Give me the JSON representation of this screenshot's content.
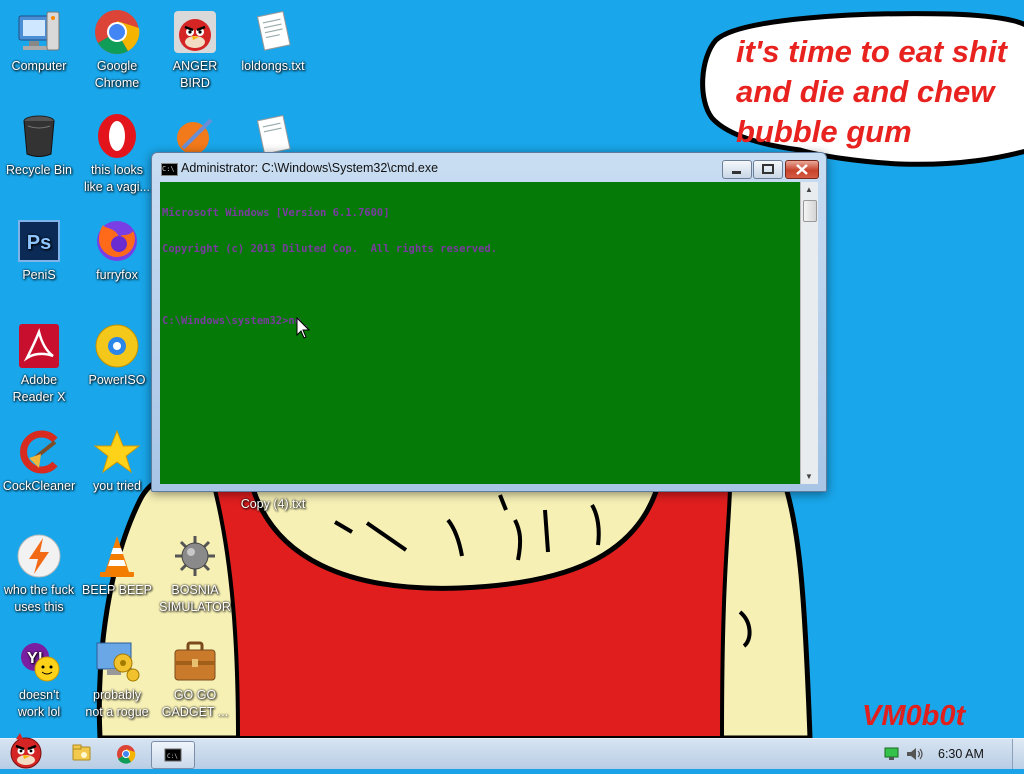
{
  "desktop_icons": [
    {
      "name": "icon-computer",
      "icon": "computer-icon",
      "label": "Computer"
    },
    {
      "name": "icon-google-chrome",
      "icon": "chrome-icon",
      "label": "Google\nChrome"
    },
    {
      "name": "icon-anger-bird",
      "icon": "angry-bird-icon",
      "label": "ANGER\nBIRD"
    },
    {
      "name": "icon-loldongs",
      "icon": "text-file-icon",
      "label": "loldongs.txt"
    },
    {
      "name": "icon-recycle-bin",
      "icon": "recycle-bin-icon",
      "label": "Recycle Bin"
    },
    {
      "name": "icon-opera",
      "icon": "opera-icon",
      "label": "this looks\nlike a vagi..."
    },
    {
      "name": "icon-photoshop",
      "icon": "photoshop-icon",
      "label": "PeniS"
    },
    {
      "name": "icon-firefox",
      "icon": "firefox-icon",
      "label": "furryfox"
    },
    {
      "name": "icon-adobe-reader",
      "icon": "adobe-reader-icon",
      "label": "Adobe\nReader X"
    },
    {
      "name": "icon-poweriso",
      "icon": "disc-icon",
      "label": "PowerISO"
    },
    {
      "name": "icon-ccleaner",
      "icon": "ccleaner-icon",
      "label": "CockCleaner"
    },
    {
      "name": "icon-you-tried",
      "icon": "star-icon",
      "label": "you tried"
    },
    {
      "name": "icon-copy4",
      "icon": "text-file-icon",
      "label": "Copy (4).txt"
    },
    {
      "name": "icon-lightning",
      "icon": "lightning-icon",
      "label": "who the fuck\nuses this"
    },
    {
      "name": "icon-vlc",
      "icon": "vlc-cone-icon",
      "label": "BEEP BEEP"
    },
    {
      "name": "icon-bosnia",
      "icon": "spiked-mine-icon",
      "label": "BOSNIA\nSIMULATOR"
    },
    {
      "name": "icon-yahoo",
      "icon": "yahoo-messenger-icon",
      "label": "doesn't\nwork lol"
    },
    {
      "name": "icon-control-panel",
      "icon": "gears-monitor-icon",
      "label": "probably\nnot a rogue"
    },
    {
      "name": "icon-gadget",
      "icon": "briefcase-icon",
      "label": "GO GO\nGADGET ..."
    }
  ],
  "cmd_window": {
    "title": "Administrator: C:\\Windows\\System32\\cmd.exe",
    "console_lines": [
      "Microsoft Windows [Version 6.1.7600]",
      "Copyright (c) 2013 Diluted Cop.  All rights reserved.",
      "",
      "C:\\Windows\\system32>no_"
    ]
  },
  "wallpaper": {
    "bubble_text": "it's time to eat shit\nand die and chew\nbubble gum",
    "signature": "VM0b0t"
  },
  "taskbar": {
    "start_icon": "angry-bird-start-icon",
    "pinned": [
      "explorer-folder-icon",
      "chrome-icon",
      "cmd-icon"
    ],
    "tray_icons": [
      "network-icon",
      "speaker-icon"
    ],
    "clock": "6:30 AM"
  },
  "colors": {
    "console_bg": "#067a06",
    "console_text": "#7a3ba0",
    "desktop": "#19a6ea",
    "bubble_text": "#e8221e"
  }
}
